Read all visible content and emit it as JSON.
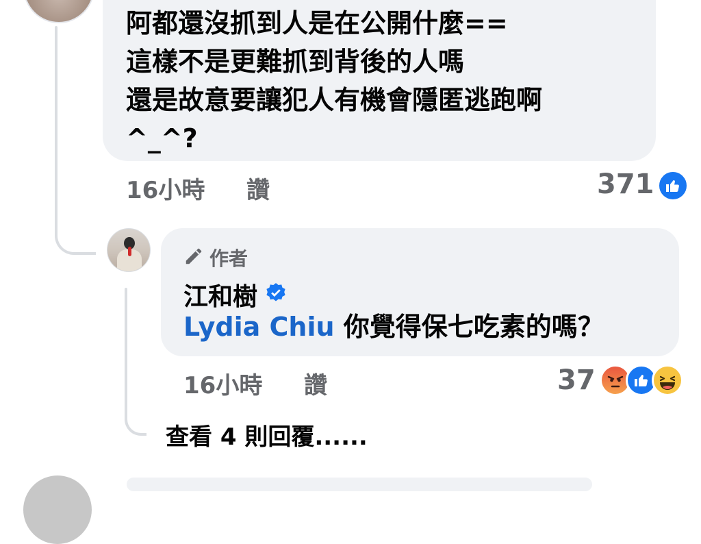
{
  "comment": {
    "text": "阿都還沒抓到人是在公開什麼==\n這樣不是更難抓到背後的人嗎\n還是故意要讓犯人有機會隱匿逃跑啊\n^_^?",
    "time": "16小時",
    "like_label": "讚",
    "reaction_count": "371",
    "reaction_icons": [
      "like-icon"
    ]
  },
  "reply": {
    "author_badge": "作者",
    "author_badge_icon": "pencil-icon",
    "name": "江和樹",
    "verified_icon": "verified-badge-icon",
    "mention": "Lydia Chiu",
    "text": "你覺得保七吃素的嗎？",
    "time": "16小時",
    "like_label": "讚",
    "reaction_count": "37",
    "reaction_icons": [
      "angry-icon",
      "like-icon",
      "haha-icon"
    ]
  },
  "view_replies": "查看 4 則回覆......",
  "colors": {
    "bubble": "#f0f2f5",
    "meta": "#65676b",
    "like_blue": "#1877f2",
    "mention": "#1b66c9",
    "text": "#050505"
  }
}
